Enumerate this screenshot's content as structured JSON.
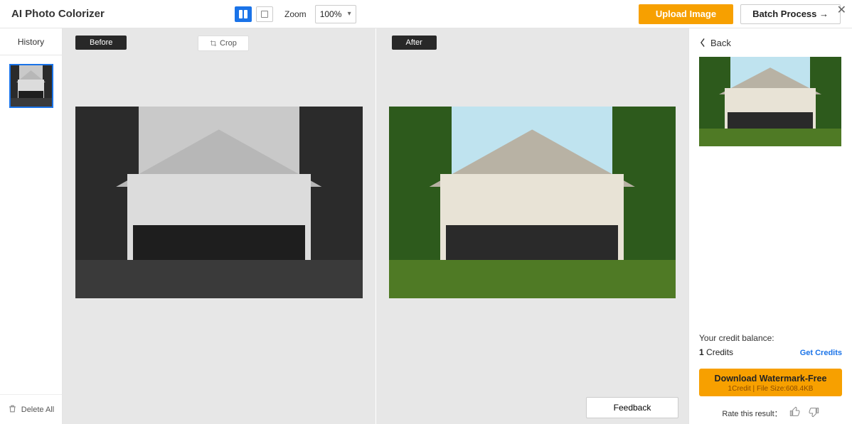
{
  "header": {
    "title": "AI Photo Colorizer",
    "zoom_label": "Zoom",
    "zoom_value": "100%",
    "upload_label": "Upload Image",
    "batch_label": "Batch Process →"
  },
  "sidebar": {
    "history_label": "History",
    "delete_all_label": "Delete All"
  },
  "workspace": {
    "before_label": "Before",
    "after_label": "After",
    "crop_label": "Crop",
    "feedback_label": "Feedback"
  },
  "rpanel": {
    "back_label": "Back",
    "credit_balance_label": "Your credit balance:",
    "credits_value": "1",
    "credits_word": "Credits",
    "get_credits_label": "Get Credits",
    "download_main": "Download Watermark-Free",
    "download_sub": "1Credit | File Size:608.4KB",
    "rate_label": "Rate this result："
  }
}
